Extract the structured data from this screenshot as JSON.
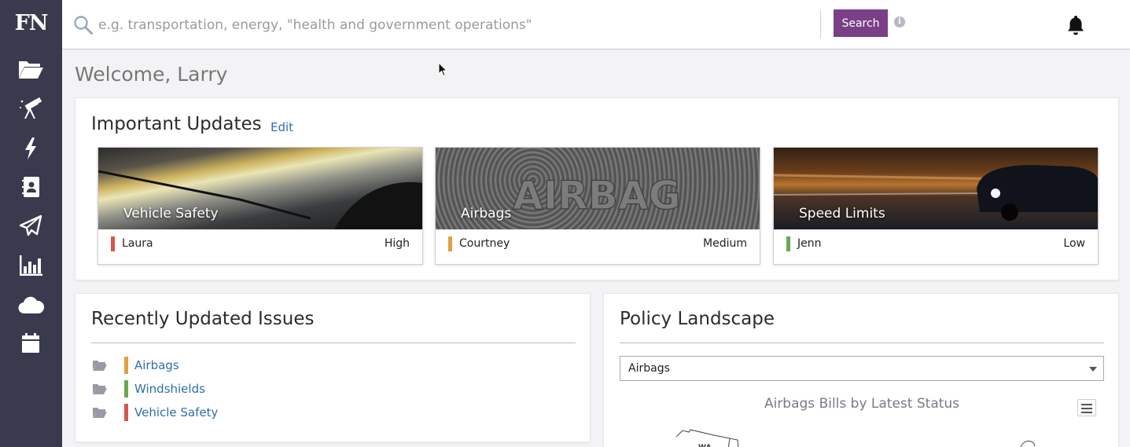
{
  "app": {
    "logo": "FN"
  },
  "sidebar": {
    "items": [
      {
        "name": "folder-open-icon"
      },
      {
        "name": "telescope-icon"
      },
      {
        "name": "lightning-icon"
      },
      {
        "name": "contacts-book-icon"
      },
      {
        "name": "paper-plane-icon"
      },
      {
        "name": "bar-chart-icon"
      },
      {
        "name": "cloud-icon"
      },
      {
        "name": "calendar-icon"
      }
    ]
  },
  "search": {
    "placeholder": "e.g. transportation, energy, \"health and government operations\"",
    "button_label": "Search",
    "info_label": "i"
  },
  "welcome": "Welcome, Larry",
  "important_updates": {
    "title": "Important Updates",
    "edit_label": "Edit",
    "cards": [
      {
        "title": "Vehicle Safety",
        "owner": "Laura",
        "priority": "High",
        "color": "#d9534f"
      },
      {
        "title": "Airbags",
        "owner": "Courtney",
        "priority": "Medium",
        "color": "#e0a040"
      },
      {
        "title": "Speed Limits",
        "owner": "Jenn",
        "priority": "Low",
        "color": "#6aa84f"
      }
    ]
  },
  "recent_issues": {
    "title": "Recently Updated Issues",
    "items": [
      {
        "name": "Airbags",
        "color": "#e0a040"
      },
      {
        "name": "Windshields",
        "color": "#6aa84f"
      },
      {
        "name": "Vehicle Safety",
        "color": "#d9534f"
      }
    ]
  },
  "policy_landscape": {
    "title": "Policy Landscape",
    "select_value": "Airbags",
    "chart_title": "Airbags Bills by Latest Status",
    "map_label": "WA"
  },
  "colors": {
    "accent": "#7a3f87",
    "sidebar": "#3a3a4e",
    "link": "#2e6fad"
  }
}
